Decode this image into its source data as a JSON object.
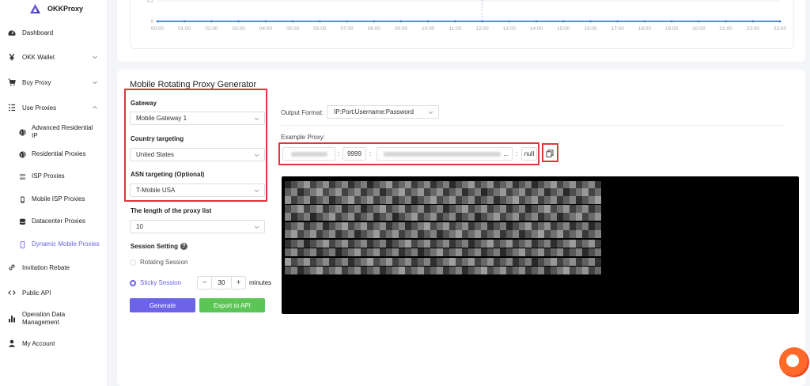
{
  "brand": {
    "name": "OKKProxy"
  },
  "sidebar": {
    "items": [
      {
        "label": "Dashboard",
        "icon": "dashboard-icon"
      },
      {
        "label": "OKK Wallet",
        "icon": "yen-icon"
      },
      {
        "label": "Buy Proxy",
        "icon": "cart-icon"
      },
      {
        "label": "Use Proxies",
        "icon": "list-icon"
      },
      {
        "label": "Invitation Rebate",
        "icon": "link-icon"
      },
      {
        "label": "Public API",
        "icon": "code-icon"
      },
      {
        "label": "Operation Data Management",
        "icon": "bar-chart-icon"
      },
      {
        "label": "My Account",
        "icon": "user-icon"
      }
    ],
    "sub_items": [
      {
        "label": "Advanced Residential IP",
        "icon": "globe-icon"
      },
      {
        "label": "Residential Proxies",
        "icon": "globe-icon"
      },
      {
        "label": "ISP Proxies",
        "icon": "server-icon"
      },
      {
        "label": "Mobile ISP Proxies",
        "icon": "phone-icon"
      },
      {
        "label": "Datacenter Proxies",
        "icon": "database-icon"
      },
      {
        "label": "Dynamic Mobile Proxies",
        "icon": "mobile-icon"
      }
    ]
  },
  "chart": {
    "y_tick_top": "0.2",
    "y_tick_zero": "0",
    "x_ticks": [
      "00:00",
      "01:00",
      "02:00",
      "03:00",
      "04:00",
      "05:00",
      "06:00",
      "07:00",
      "08:00",
      "09:00",
      "10:00",
      "11:00",
      "12:00",
      "13:00",
      "14:00",
      "15:00",
      "16:00",
      "17:00",
      "18:00",
      "19:00",
      "20:00",
      "21:00",
      "22:00",
      "23:00"
    ]
  },
  "chart_data": {
    "type": "line",
    "x": [
      "00:00",
      "01:00",
      "02:00",
      "03:00",
      "04:00",
      "05:00",
      "06:00",
      "07:00",
      "08:00",
      "09:00",
      "10:00",
      "11:00",
      "12:00",
      "13:00",
      "14:00",
      "15:00",
      "16:00",
      "17:00",
      "18:00",
      "19:00",
      "20:00",
      "21:00",
      "22:00",
      "23:00"
    ],
    "series": [
      {
        "values": [
          0,
          0,
          0,
          0,
          0,
          0,
          0,
          0,
          0,
          0,
          0,
          0,
          0,
          0,
          0,
          0,
          0,
          0,
          0,
          0,
          0,
          0,
          0,
          0
        ]
      }
    ],
    "ylim": [
      0,
      0.2
    ],
    "color": "#3d7be0"
  },
  "generator": {
    "title": "Mobile Rotating Proxy Generator",
    "gateway_label": "Gateway",
    "gateway_value": "Mobile Gateway 1",
    "country_label": "Country targeting",
    "country_value": "United States",
    "asn_label": "ASN targeting (Optional)",
    "asn_value": "T-Mobile USA",
    "length_label": "The length of the proxy list",
    "length_value": "10",
    "session_label": "Session Setting",
    "help": "?",
    "rotating_label": "Rotating Session",
    "sticky_label": "Sticky Session",
    "sticky_minutes": "30",
    "minus": "−",
    "plus": "+",
    "minutes_label": "minutes",
    "generate_label": "Generate",
    "export_label": "Export to API"
  },
  "output": {
    "format_label": "Output Format:",
    "format_value": "IP:Port:Username:Password",
    "example_label": "Example Proxy:",
    "port": "9999",
    "password": "null",
    "colon": ":",
    "ellipsis": "..."
  },
  "colors": {
    "accent": "#6c63e8",
    "green": "#5cc655",
    "highlight": "#e0353d"
  }
}
